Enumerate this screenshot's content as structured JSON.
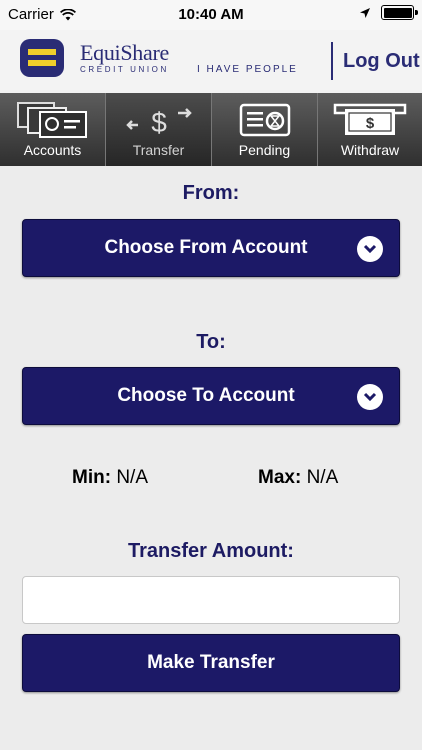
{
  "status_bar": {
    "carrier": "Carrier",
    "time": "10:40 AM"
  },
  "header": {
    "brand_name": "EquiShare",
    "brand_sub": "CREDIT UNION",
    "tagline": "I HAVE PEOPLE",
    "logout_label": "Log Out"
  },
  "tabs": [
    {
      "label": "Accounts",
      "icon": "accounts-icon"
    },
    {
      "label": "Transfer",
      "icon": "transfer-icon"
    },
    {
      "label": "Pending",
      "icon": "pending-icon"
    },
    {
      "label": "Withdraw",
      "icon": "withdraw-icon"
    }
  ],
  "active_tab": "Transfer",
  "form": {
    "from_label": "From:",
    "from_select": "Choose From Account",
    "to_label": "To:",
    "to_select": "Choose To Account",
    "min_label": "Min:",
    "min_value": "N/A",
    "max_label": "Max:",
    "max_value": "N/A",
    "amount_label": "Transfer Amount:",
    "amount_value": "",
    "submit_label": "Make Transfer"
  },
  "colors": {
    "brand_navy": "#1c1967",
    "brand_gold": "#f0cf2b",
    "background": "#ececec",
    "tabbar_dark": "#3a3a3a"
  }
}
